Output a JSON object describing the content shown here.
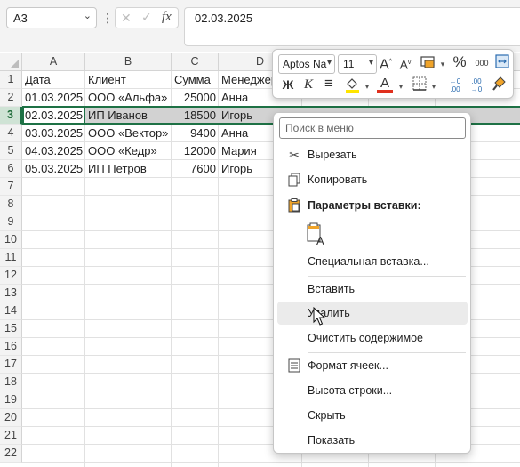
{
  "formula_bar": {
    "name_box": "A3",
    "name_box_arrow": "⌄",
    "more": "⋮",
    "cancel": "✕",
    "enter": "✓",
    "fx": "fx",
    "formula": "02.03.2025"
  },
  "columns": [
    "A",
    "B",
    "C",
    "D"
  ],
  "rows": [
    "1",
    "2",
    "3",
    "4",
    "5",
    "6",
    "7",
    "8",
    "9",
    "10",
    "11",
    "12",
    "13",
    "14",
    "15",
    "16",
    "17",
    "18",
    "19",
    "20",
    "21",
    "22"
  ],
  "selected_row": "3",
  "cells": [
    [
      "Дата",
      "Клиент",
      "Сумма",
      "Менеджер"
    ],
    [
      "01.03.2025",
      "ООО «Альфа»",
      "25000",
      "Анна"
    ],
    [
      "02.03.2025",
      "ИП Иванов",
      "18500",
      "Игорь"
    ],
    [
      "03.03.2025",
      "ООО «Вектор»",
      "9400",
      "Анна"
    ],
    [
      "04.03.2025",
      "ООО «Кедр»",
      "12000",
      "Мария"
    ],
    [
      "05.03.2025",
      "ИП Петров",
      "7600",
      "Игорь"
    ]
  ],
  "mini_toolbar": {
    "font_name": "Aptos Na",
    "font_size": "11",
    "grow_font": "A",
    "shrink_font": "A",
    "percent": "%",
    "thousands": "000",
    "bold": "Ж",
    "italic": "К",
    "align": "≡",
    "fill_color": "#ffe500",
    "font_color": "#e0301e",
    "font_letter": "A"
  },
  "context_menu": {
    "search_placeholder": "Поиск в меню",
    "cut": "Вырезать",
    "copy": "Копировать",
    "paste_options": "Параметры вставки:",
    "paste_special": "Специальная вставка...",
    "insert": "Вставить",
    "delete": "Удалить",
    "clear": "Очистить содержимое",
    "format_cells": "Формат ячеек...",
    "row_height": "Высота строки...",
    "hide": "Скрыть",
    "show": "Показать"
  },
  "colors": {
    "accent": "#1e7145",
    "selection": "#d2d2d2"
  }
}
